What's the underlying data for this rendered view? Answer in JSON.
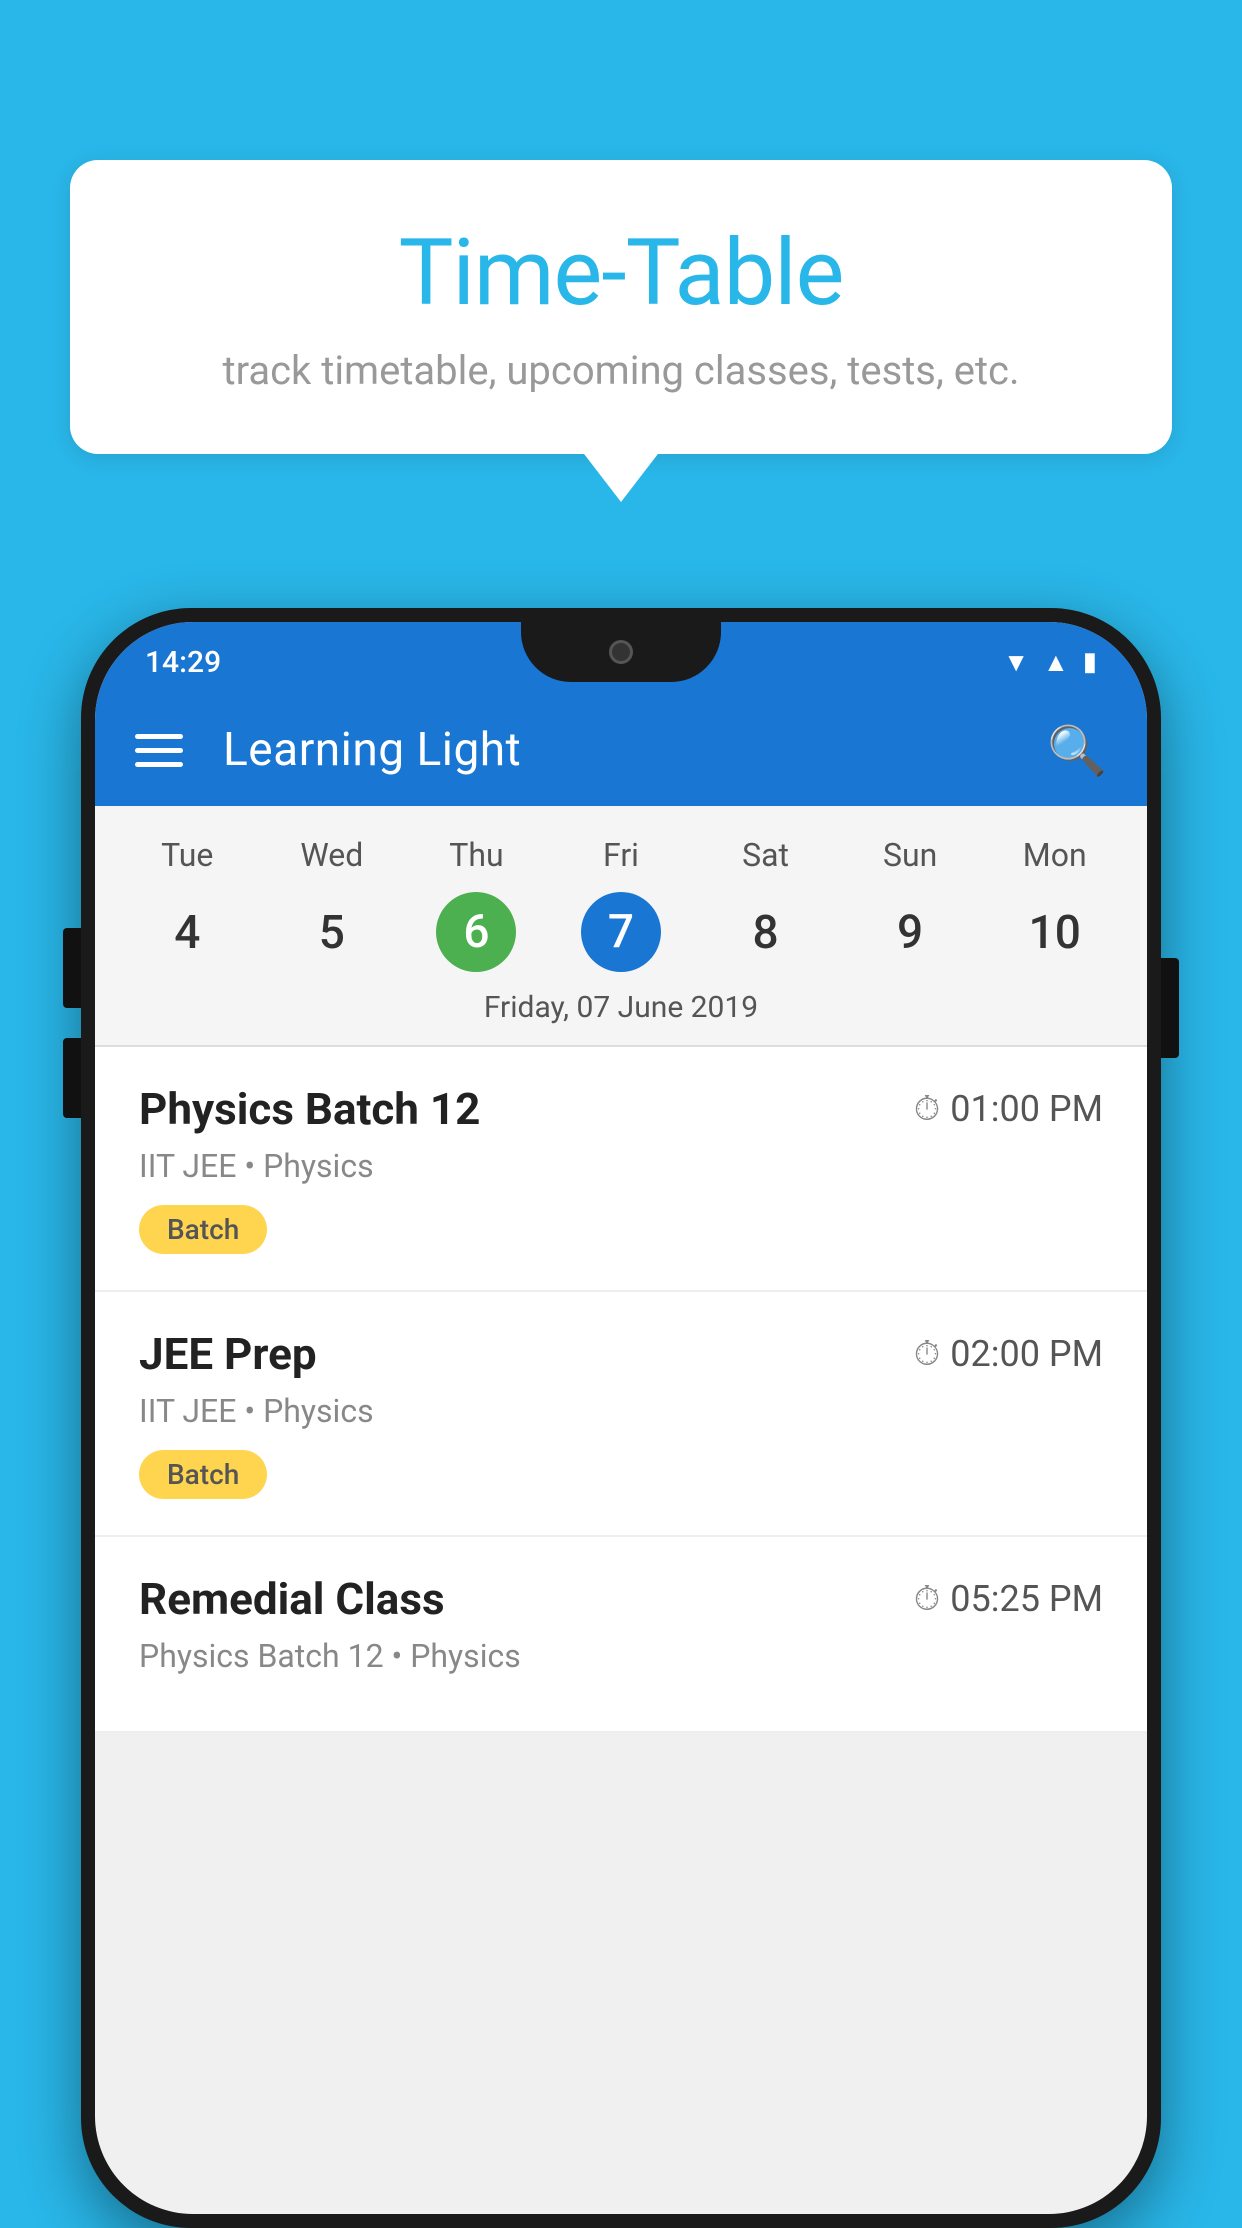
{
  "background_color": "#29b6e8",
  "tooltip": {
    "title": "Time-Table",
    "subtitle": "track timetable, upcoming classes, tests, etc."
  },
  "status_bar": {
    "time": "14:29"
  },
  "app_bar": {
    "title": "Learning Light"
  },
  "calendar": {
    "days": [
      "Tue",
      "Wed",
      "Thu",
      "Fri",
      "Sat",
      "Sun",
      "Mon"
    ],
    "dates": [
      "4",
      "5",
      "6",
      "7",
      "8",
      "9",
      "10"
    ],
    "today_index": 2,
    "selected_index": 3,
    "date_label": "Friday, 07 June 2019"
  },
  "schedule": [
    {
      "name": "Physics Batch 12",
      "time": "01:00 PM",
      "meta": "IIT JEE • Physics",
      "badge": "Batch"
    },
    {
      "name": "JEE Prep",
      "time": "02:00 PM",
      "meta": "IIT JEE • Physics",
      "badge": "Batch"
    },
    {
      "name": "Remedial Class",
      "time": "05:25 PM",
      "meta": "Physics Batch 12 • Physics",
      "badge": null
    }
  ]
}
